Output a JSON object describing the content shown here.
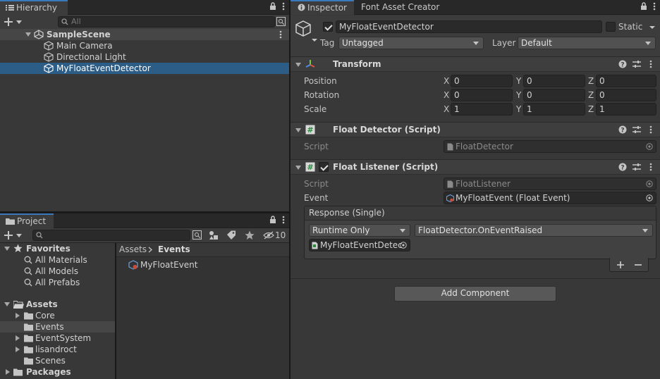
{
  "hierarchy": {
    "tab_label": "Hierarchy",
    "search_placeholder": "All",
    "items": [
      {
        "label": "SampleScene"
      },
      {
        "label": "Main Camera"
      },
      {
        "label": "Directional Light"
      },
      {
        "label": "MyFloatEventDetector"
      }
    ]
  },
  "project": {
    "tab_label": "Project",
    "hidden_count": "10",
    "favorites": {
      "label": "Favorites",
      "items": [
        "All Materials",
        "All Models",
        "All Prefabs"
      ]
    },
    "assets": {
      "label": "Assets",
      "folders": [
        "Core",
        "Events",
        "EventSystem",
        "lisandroct",
        "Scenes"
      ]
    },
    "packages_label": "Packages",
    "breadcrumb": {
      "root": "Assets",
      "current": "Events"
    },
    "files": [
      "MyFloatEvent"
    ]
  },
  "inspector": {
    "tabs": [
      "Inspector",
      "Font Asset Creator"
    ],
    "object_name": "MyFloatEventDetector",
    "static_label": "Static",
    "tag_label": "Tag",
    "tag_value": "Untagged",
    "layer_label": "Layer",
    "layer_value": "Default",
    "transform": {
      "title": "Transform",
      "rows": [
        {
          "label": "Position",
          "x": "0",
          "y": "0",
          "z": "0"
        },
        {
          "label": "Rotation",
          "x": "0",
          "y": "0",
          "z": "0"
        },
        {
          "label": "Scale",
          "x": "1",
          "y": "1",
          "z": "1"
        }
      ],
      "axis": {
        "x": "X",
        "y": "Y",
        "z": "Z"
      }
    },
    "float_detector": {
      "title": "Float Detector (Script)",
      "script_label": "Script",
      "script_value": "FloatDetector"
    },
    "float_listener": {
      "title": "Float Listener (Script)",
      "script_label": "Script",
      "script_value": "FloatListener",
      "event_label": "Event",
      "event_value": "MyFloatEvent (Float Event)",
      "response_title": "Response (Single)",
      "runtime_value": "Runtime Only",
      "function_value": "FloatDetector.OnEventRaised",
      "target_value": "MyFloatEventDetec"
    },
    "add_component_label": "Add Component"
  },
  "colors": {
    "selection": "#2c5d87",
    "panel": "#383838",
    "tab_accent": "#3a79bb"
  }
}
